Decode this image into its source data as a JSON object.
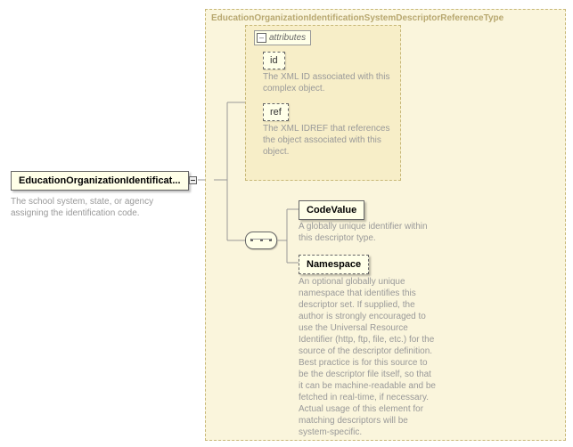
{
  "root": {
    "name": "EducationOrganizationIdentificat...",
    "description": "The school system, state, or agency assigning the identification code."
  },
  "typeContainer": {
    "title": "EducationOrganizationIdentificationSystemDescriptorReferenceType"
  },
  "attributes": {
    "label": "attributes",
    "items": [
      {
        "name": "id",
        "desc": "The XML ID associated with this complex object."
      },
      {
        "name": "ref",
        "desc": "The XML IDREF that references the object associated with this object."
      }
    ]
  },
  "elements": [
    {
      "name": "CodeValue",
      "required": true,
      "desc": "A globally unique identifier within this descriptor type."
    },
    {
      "name": "Namespace",
      "required": false,
      "desc": "An optional globally unique namespace that identifies this descriptor set. If supplied, the author is strongly encouraged to use the Universal Resource Identifier (http, ftp, file, etc.) for the source of the descriptor definition. Best practice is for this source to be the descriptor file itself, so that it can be machine-readable and be fetched in real-time, if necessary. Actual usage of this element for matching descriptors will be system-specific."
    }
  ]
}
